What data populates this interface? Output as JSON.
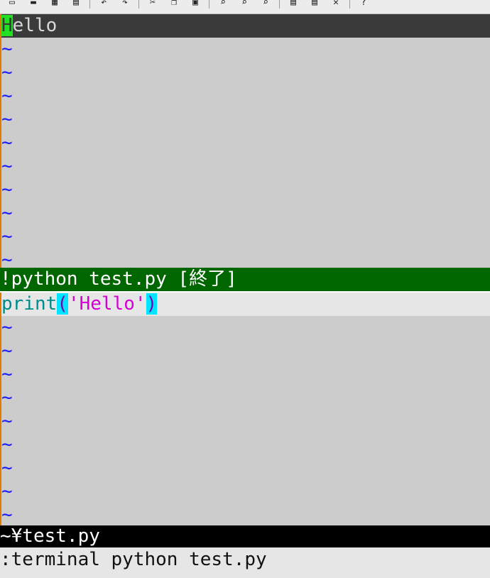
{
  "toolbar": {
    "buttons": [
      {
        "icon": "open-icon",
        "glyph": "▭"
      },
      {
        "icon": "save-icon",
        "glyph": "▬"
      },
      {
        "icon": "save-all-icon",
        "glyph": "▦"
      },
      {
        "icon": "print-icon",
        "glyph": "▤"
      },
      {
        "icon": "undo-icon",
        "glyph": "↶"
      },
      {
        "icon": "redo-icon",
        "glyph": "↷"
      },
      {
        "icon": "cut-icon",
        "glyph": "✂"
      },
      {
        "icon": "copy-icon",
        "glyph": "❐"
      },
      {
        "icon": "paste-icon",
        "glyph": "▣"
      },
      {
        "icon": "find-icon",
        "glyph": "⌕"
      },
      {
        "icon": "find-next-icon",
        "glyph": "⌕"
      },
      {
        "icon": "find-prev-icon",
        "glyph": "⌕"
      },
      {
        "icon": "load-session-icon",
        "glyph": "▤"
      },
      {
        "icon": "save-session-icon",
        "glyph": "▤"
      },
      {
        "icon": "run-script-icon",
        "glyph": "✕"
      },
      {
        "icon": "help-icon",
        "glyph": "?"
      }
    ]
  },
  "terminal_pane": {
    "output_first_char": "H",
    "output_rest": "ello",
    "tilde": "~",
    "tilde_count": 10
  },
  "terminal_status": "!python test.py [終了]",
  "editor_pane": {
    "code": {
      "func": "print",
      "open_paren": "(",
      "string": "'Hello'",
      "close_paren": ")"
    },
    "tilde": "~",
    "tilde_count": 9
  },
  "file_status": "~¥test.py",
  "command_line": ":terminal python test.py",
  "colors": {
    "background": "#cccccc",
    "terminal_status_bg": "#006600",
    "file_status_bg": "#000000",
    "tilde": "#1a1aff",
    "cursor": "#22e022",
    "paren_highlight": "#00e5ff",
    "string": "#d400d4",
    "keyword": "#008b8b"
  }
}
